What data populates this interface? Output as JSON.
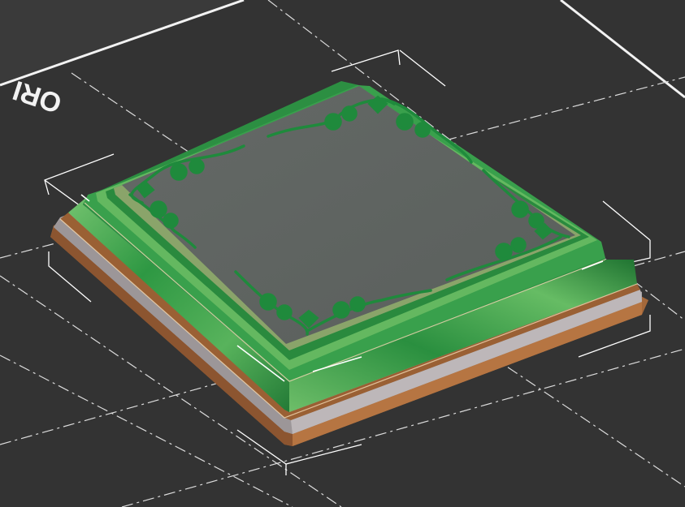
{
  "viewport": {
    "bed_label": "ORI",
    "colors": {
      "background": "#3a3a3a",
      "bed_surface": "#333333",
      "bed_edge": "#f2f2f2",
      "grid_line": "#dcdcdc",
      "bounding_box": "#ffffff",
      "model_top": "#5f6461",
      "model_frame_green": "#2f9a47",
      "model_frame_light": "#78c876",
      "model_bottom_gray": "#a7a2a4",
      "model_base_brown": "#a4683a",
      "ornament_green": "#1f8a3c"
    }
  }
}
